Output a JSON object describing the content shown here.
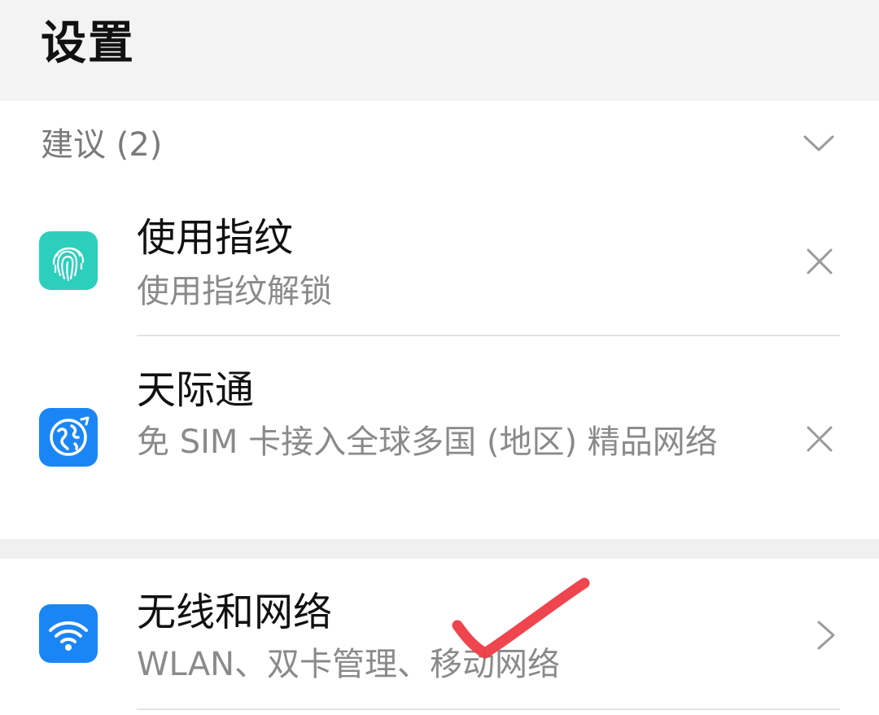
{
  "header": {
    "title": "设置"
  },
  "suggestions": {
    "title": "建议 (2)",
    "collapse_icon": "chevron-down-icon",
    "items": [
      {
        "title": "使用指纹",
        "subtitle": "使用指纹解锁",
        "icon": "fingerprint-icon",
        "icon_color": "#2ccfbc",
        "dismiss_icon": "close-icon"
      },
      {
        "title": "天际通",
        "subtitle": "免 SIM 卡接入全球多国 (地区) 精品网络",
        "icon": "globe-icon",
        "icon_color": "#1a86f5",
        "dismiss_icon": "close-icon"
      }
    ]
  },
  "settings": {
    "items": [
      {
        "title": "无线和网络",
        "subtitle": "WLAN、双卡管理、移动网络",
        "icon": "wifi-icon",
        "icon_color": "#1a86f5",
        "trailing_icon": "chevron-right-icon"
      }
    ]
  },
  "annotation": {
    "mark": "red-checkmark",
    "color": "#ee3b44"
  }
}
